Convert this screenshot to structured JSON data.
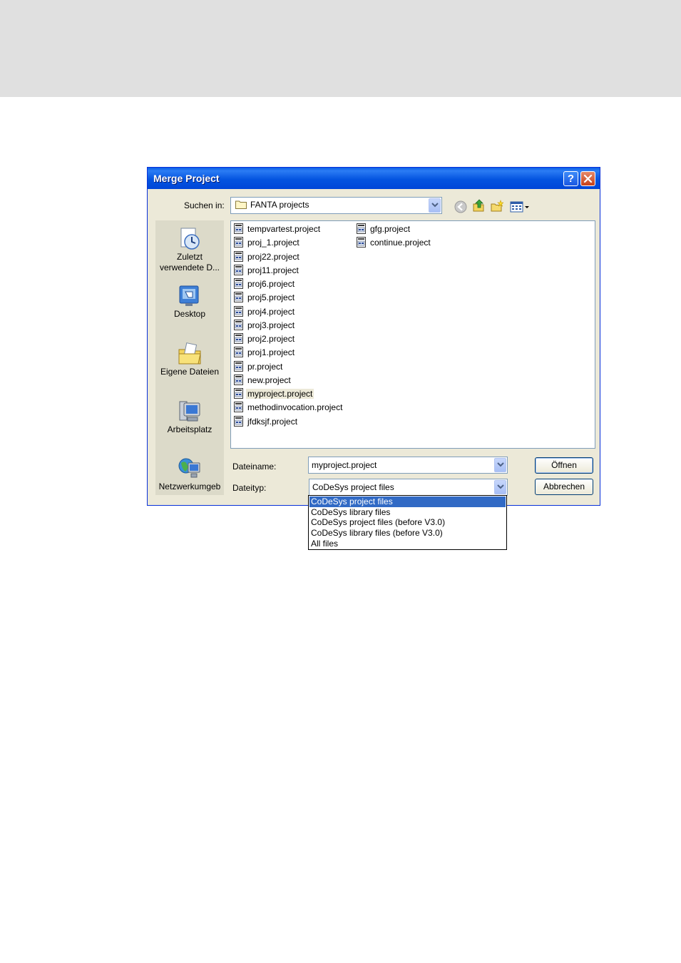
{
  "dialog": {
    "title": "Merge Project",
    "help_icon": "help-icon",
    "close_icon": "close-icon"
  },
  "lookin": {
    "label": "Suchen in:",
    "value": "FANTA projects"
  },
  "places": [
    {
      "label_line1": "Zuletzt",
      "label_line2": "verwendete D...",
      "icon": "recent-documents-icon"
    },
    {
      "label_line1": "Desktop",
      "label_line2": "",
      "icon": "desktop-icon"
    },
    {
      "label_line1": "Eigene Dateien",
      "label_line2": "",
      "icon": "my-documents-icon"
    },
    {
      "label_line1": "Arbeitsplatz",
      "label_line2": "",
      "icon": "my-computer-icon"
    },
    {
      "label_line1": "Netzwerkumgeb",
      "label_line2": "",
      "icon": "network-icon"
    }
  ],
  "files": [
    "tempvartest.project",
    "proj_1.project",
    "proj22.project",
    "proj11.project",
    "proj6.project",
    "proj5.project",
    "proj4.project",
    "proj3.project",
    "proj2.project",
    "proj1.project",
    "pr.project",
    "new.project",
    "myproject.project",
    "methodinvocation.project",
    "jfdksjf.project",
    "gfg.project",
    "continue.project"
  ],
  "selected_file": "myproject.project",
  "filename": {
    "label": "Dateiname:",
    "value": "myproject.project"
  },
  "filetype": {
    "label": "Dateityp:",
    "value": "CoDeSys project files",
    "options": [
      "CoDeSys project files",
      "CoDeSys library files",
      "CoDeSys project files (before V3.0)",
      "CoDeSys library files (before V3.0)",
      "All files"
    ],
    "highlighted": "CoDeSys project files"
  },
  "buttons": {
    "open": "Öffnen",
    "cancel": "Abbrechen"
  },
  "colors": {
    "titlebar": "#0454e0",
    "selection": "#316ac5",
    "dialog_face": "#ece9d8"
  }
}
